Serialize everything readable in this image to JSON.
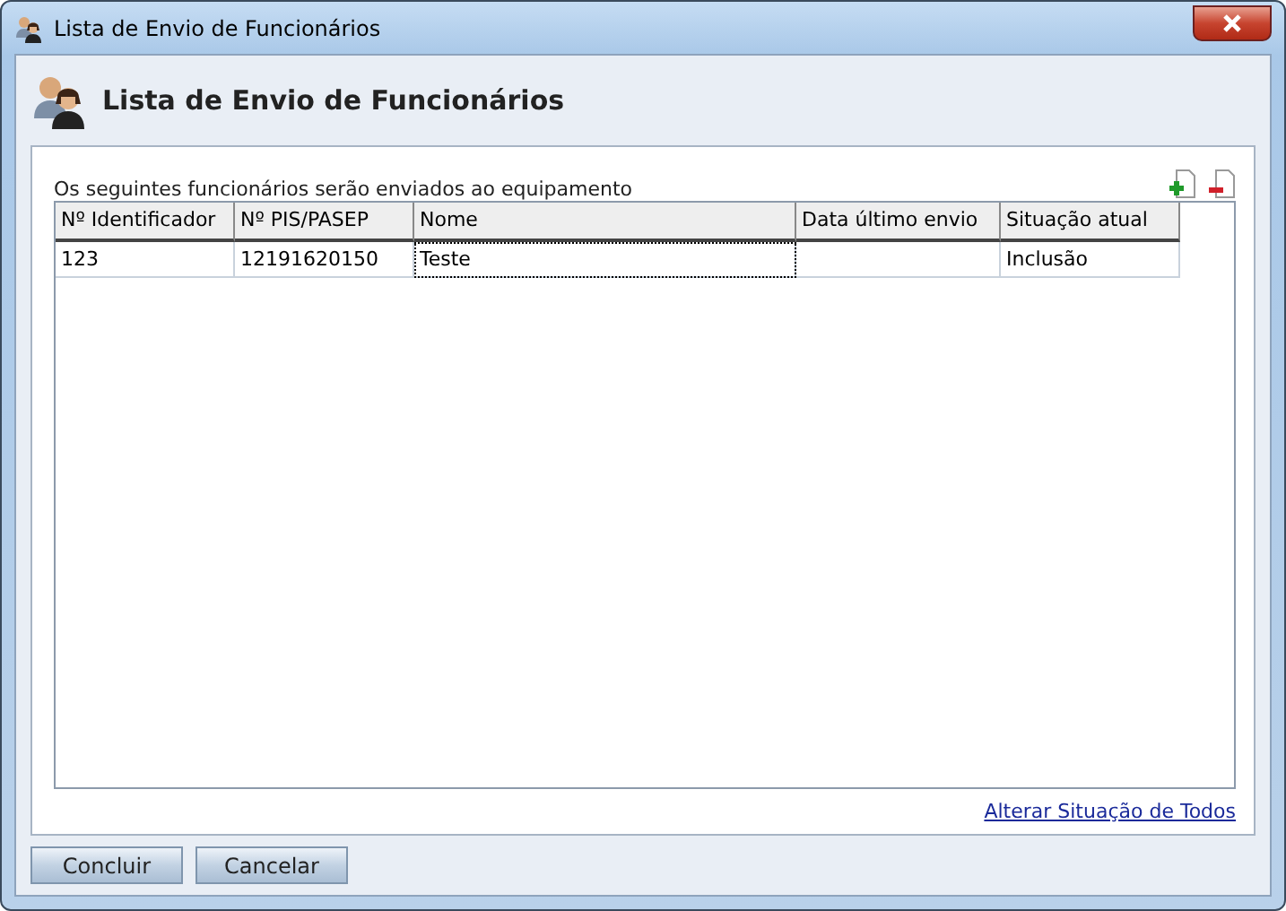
{
  "window": {
    "title": "Lista de Envio de Funcionários"
  },
  "header": {
    "title": "Lista de Envio de Funcionários"
  },
  "panel": {
    "caption": "Os seguintes funcionários serão enviados ao equipamento",
    "table": {
      "columns": [
        "Nº Identificador",
        "Nº PIS/PASEP",
        "Nome",
        "Data último envio",
        "Situação atual"
      ],
      "rows": [
        {
          "cells": [
            {
              "text": "123",
              "focused": false
            },
            {
              "text": "12191620150",
              "focused": false
            },
            {
              "text": "Teste",
              "focused": true
            },
            {
              "focused": false
            },
            {
              "text": "Inclusão",
              "focused": false
            }
          ]
        }
      ]
    },
    "link": "Alterar Situação de Todos"
  },
  "buttons": [
    "Concluir",
    "Cancelar"
  ]
}
